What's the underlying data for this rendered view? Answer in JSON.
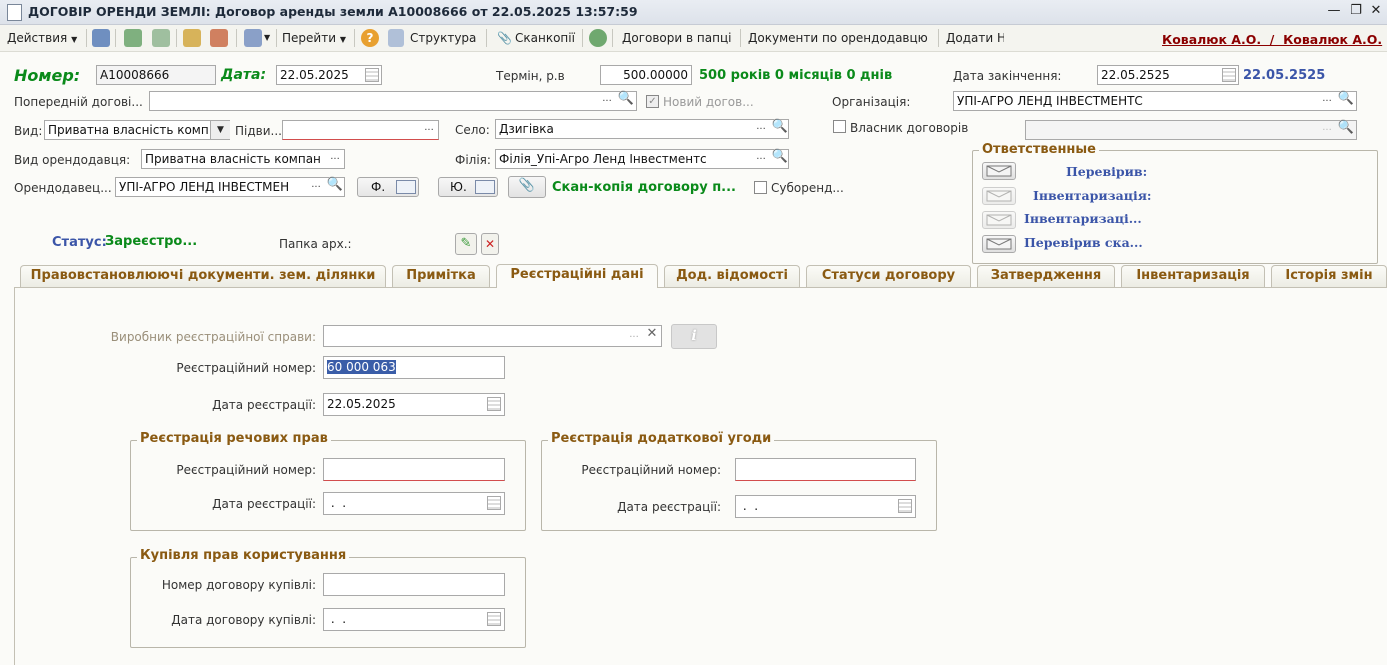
{
  "window": {
    "title": "ДОГОВІР ОРЕНДИ ЗЕМЛІ: Договор аренды земли А10008666 от 22.05.2025 13:57:59"
  },
  "toolbar": {
    "actions": "Действия",
    "goto": "Перейти",
    "structure": "Структура",
    "scans": "Сканкопії",
    "folder_contracts": "Договори в папці",
    "lessor_docs": "Документи по орендодавцю",
    "add": "Додати Н",
    "user": "Ковалюк А.О.  /  Ковалюк А.О."
  },
  "header": {
    "number_label": "Номер:",
    "number_value": "А10008666",
    "date_label": "Дата:",
    "date_value": "22.05.2025",
    "term_label": "Термін, р.в",
    "term_value": "500.00000",
    "term_text": "500 років 0 місяців 0 днів",
    "end_label": "Дата закінчення:",
    "end_value": "22.05.2525",
    "end_text": "22.05.2525",
    "prev_label": "Попередній догові...",
    "new_contract_label": "Новий догов...",
    "org_label": "Організація:",
    "org_value": "УПІ-АГРО ЛЕНД ІНВЕСТМЕНТС",
    "kind_label": "Вид:",
    "kind_value": "Приватна власність комп",
    "subkind_label": "Підви...",
    "village_label": "Село:",
    "village_value": "Дзигівка",
    "owner_label": "Власник договорів",
    "lessor_kind_label": "Вид орендодавця:",
    "lessor_kind_value": "Приватна власність компан",
    "branch_label": "Філія:",
    "branch_value": "Філія_Упі-Агро Ленд Інвестментс",
    "lessor_label": "Орендодавец...",
    "lessor_value": "УПІ-АГРО ЛЕНД ІНВЕСТМЕН",
    "f_label": "Ф.",
    "yu_label": "Ю.",
    "scan_text": "Скан-копія договору п...",
    "sublease_label": "Суборенд...",
    "status_label": "Статус:",
    "status_value": "Зареєстро...",
    "archive_label": "Папка арх.:"
  },
  "responsible": {
    "title": "Ответственные",
    "items": [
      "Перевірив:",
      "Інвентаризація:",
      "Інвентаризаці...",
      "Перевірив ска..."
    ]
  },
  "tabs": [
    "Правовстановлюючі документи. зем. ділянки",
    "Примітка",
    "Реєстраційні дані",
    "Дод. відомості",
    "Статуси договору",
    "Затвердження",
    "Інвентаризація",
    "Історія змін"
  ],
  "registration": {
    "maker_label": "Виробник реєстраційної справи:",
    "reg_number_label": "Реєстраційний номер:",
    "reg_number_value": "60 000 063",
    "reg_date_label": "Дата реєстрації:",
    "reg_date_value": "22.05.2025",
    "rights_group": {
      "title": "Реєстрація речових прав",
      "number_label": "Реєстраційний номер:",
      "date_label": "Дата реєстрації:",
      "date_value": " .  ."
    },
    "addendum_group": {
      "title": "Реєстрація додаткової угоди",
      "number_label": "Реєстраційний номер:",
      "date_label": "Дата реєстрації:",
      "date_value": " .  ."
    },
    "purchase_group": {
      "title": "Купівля прав користування",
      "number_label": "Номер договору купівлі:",
      "date_label": "Дата договору купівлі:",
      "date_value": " .  ."
    }
  }
}
